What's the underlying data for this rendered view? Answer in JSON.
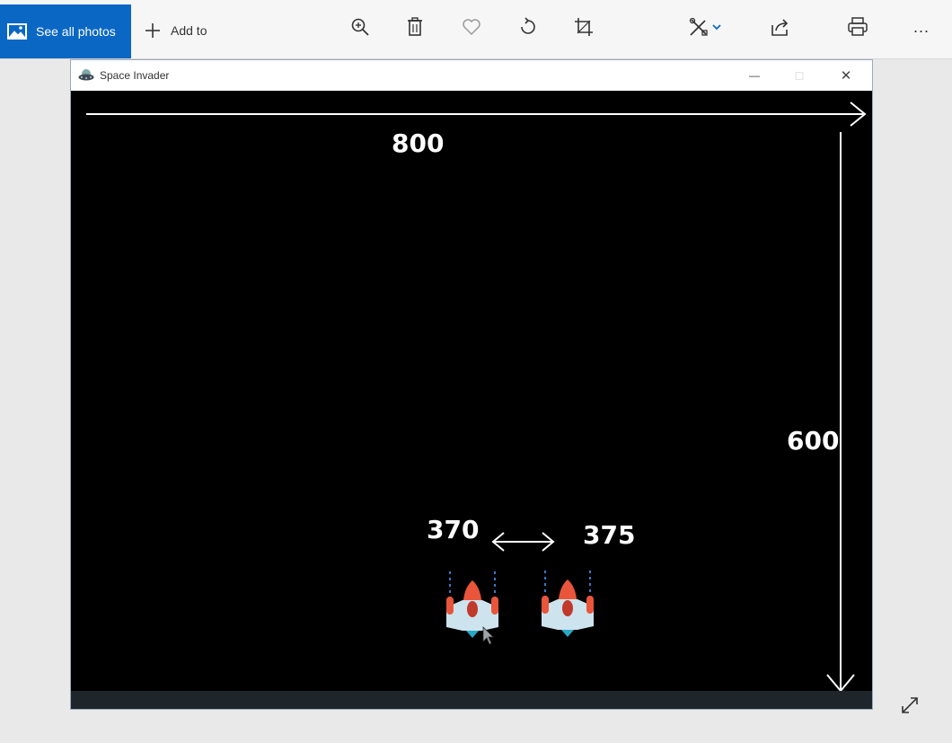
{
  "toolbar": {
    "see_all_label": "See all photos",
    "add_to_label": "Add to",
    "icons": [
      "zoom-in-icon",
      "delete-icon",
      "heart-icon",
      "rotate-icon",
      "crop-icon",
      "edit-create-icon",
      "share-icon",
      "print-icon",
      "more-icon"
    ],
    "more_glyph": "..."
  },
  "window": {
    "title": "Space Invader",
    "minimize_glyph": "—",
    "maximize_glyph": "□",
    "close_glyph": "✕"
  },
  "annotations": {
    "width_label": "800",
    "height_label": "600",
    "left_x_label": "370",
    "right_x_label": "375"
  },
  "colors": {
    "accent": "#0a67c4",
    "game_background": "#000000",
    "annotation": "#ffffff",
    "ship_body": "#cde3ee",
    "ship_nose": "#e8553a",
    "ship_thruster": "#3a78c8"
  }
}
